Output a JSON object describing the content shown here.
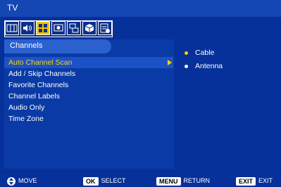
{
  "title": "TV",
  "icon_tabs": [
    {
      "name": "picture-icon",
      "selected": false
    },
    {
      "name": "audio-icon",
      "selected": false
    },
    {
      "name": "channel-setup-icon",
      "selected": true
    },
    {
      "name": "screen-icon",
      "selected": false
    },
    {
      "name": "pc-icon",
      "selected": false
    },
    {
      "name": "lock-icon",
      "selected": false
    },
    {
      "name": "setup-icon",
      "selected": false
    }
  ],
  "section_title": "Channels",
  "menu": [
    "Auto Channel Scan",
    "Add / Skip Channels",
    "Favorite Channels",
    "Channel Labels",
    "Audio Only",
    "Time Zone"
  ],
  "selected_menu_index": 0,
  "options": [
    {
      "label": "Cable",
      "selected": true
    },
    {
      "label": "Antenna",
      "selected": false
    }
  ],
  "footer": {
    "move": "MOVE",
    "ok_key": "OK",
    "select": "SELECT",
    "menu_key": "MENU",
    "return": "RETURN",
    "exit_key": "EXIT",
    "exit": "EXIT"
  },
  "colors": {
    "accent": "#ffd200",
    "background": "#06309a"
  }
}
